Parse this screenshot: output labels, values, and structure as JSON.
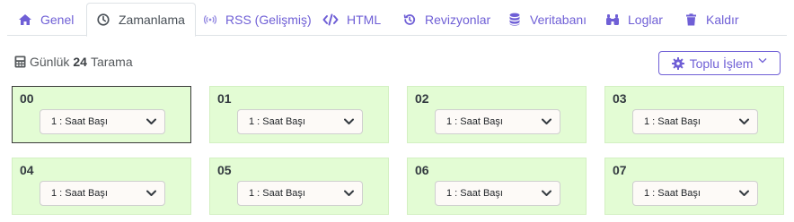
{
  "tabs": [
    {
      "label": "Genel",
      "icon": "home-icon"
    },
    {
      "label": "Zamanlama",
      "icon": "clock-icon",
      "active": true
    },
    {
      "label": "RSS (Gelişmiş)",
      "icon": "rss-icon"
    },
    {
      "label": "HTML",
      "icon": "code-icon"
    },
    {
      "label": "Revizyonlar",
      "icon": "history-icon"
    },
    {
      "label": "Veritabanı",
      "icon": "database-icon"
    },
    {
      "label": "Loglar",
      "icon": "binoculars-icon"
    },
    {
      "label": "Kaldır",
      "icon": "trash-icon"
    }
  ],
  "info": {
    "prefix": "Günlük",
    "count": "24",
    "suffix": "Tarama",
    "icon": "calculator-icon"
  },
  "bulk": {
    "label": "Toplu İşlem",
    "icon": "gear-icon"
  },
  "hours": [
    {
      "hour": "00",
      "value": "1 : Saat Başı",
      "selected": true
    },
    {
      "hour": "01",
      "value": "1 : Saat Başı"
    },
    {
      "hour": "02",
      "value": "1 : Saat Başı"
    },
    {
      "hour": "03",
      "value": "1 : Saat Başı"
    },
    {
      "hour": "04",
      "value": "1 : Saat Başı"
    },
    {
      "hour": "05",
      "value": "1 : Saat Başı"
    },
    {
      "hour": "06",
      "value": "1 : Saat Başı"
    },
    {
      "hour": "07",
      "value": "1 : Saat Başı"
    }
  ],
  "colors": {
    "accent": "#6f5fd6",
    "card_bg": "#e3fcd4",
    "tab_text": "#6f5fd6"
  }
}
